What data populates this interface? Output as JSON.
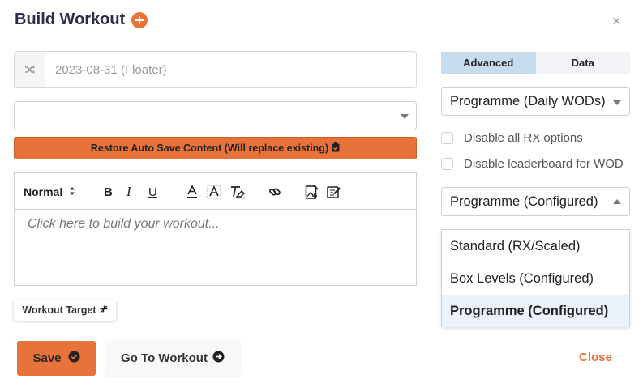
{
  "dialog": {
    "title": "Build Workout",
    "close_symbol": "×"
  },
  "date_field": {
    "value": "2023-08-31 (Floater)",
    "addon_icon": "shuffle-icon"
  },
  "workout_select": {
    "value": ""
  },
  "restore_button": {
    "label": "Restore Auto Save Content (Will replace existing)",
    "icon": "clipboard-check-icon",
    "color": "#e8733a"
  },
  "editor": {
    "format_label": "Normal",
    "placeholder": "Click here to build your workout..."
  },
  "workout_target": {
    "label": "Workout Target",
    "icon": "compress-icon"
  },
  "footer": {
    "save_label": "Save",
    "goto_label": "Go To Workout",
    "close_label": "Close"
  },
  "tabs": [
    {
      "label": "Advanced",
      "active": true
    },
    {
      "label": "Data",
      "active": false
    }
  ],
  "programme_select": {
    "value": "Programme (Daily WODs)"
  },
  "options": {
    "disable_rx": "Disable all RX options",
    "disable_leaderboard": "Disable leaderboard for WOD"
  },
  "scaling_select": {
    "value": "Programme (Configured)",
    "options": [
      "Standard (RX/Scaled)",
      "Box Levels (Configured)",
      "Programme (Configured)"
    ],
    "selected_index": 2
  },
  "colors": {
    "accent": "#e8733a",
    "title": "#2b2f4a",
    "active_tab": "#c7dcec"
  }
}
